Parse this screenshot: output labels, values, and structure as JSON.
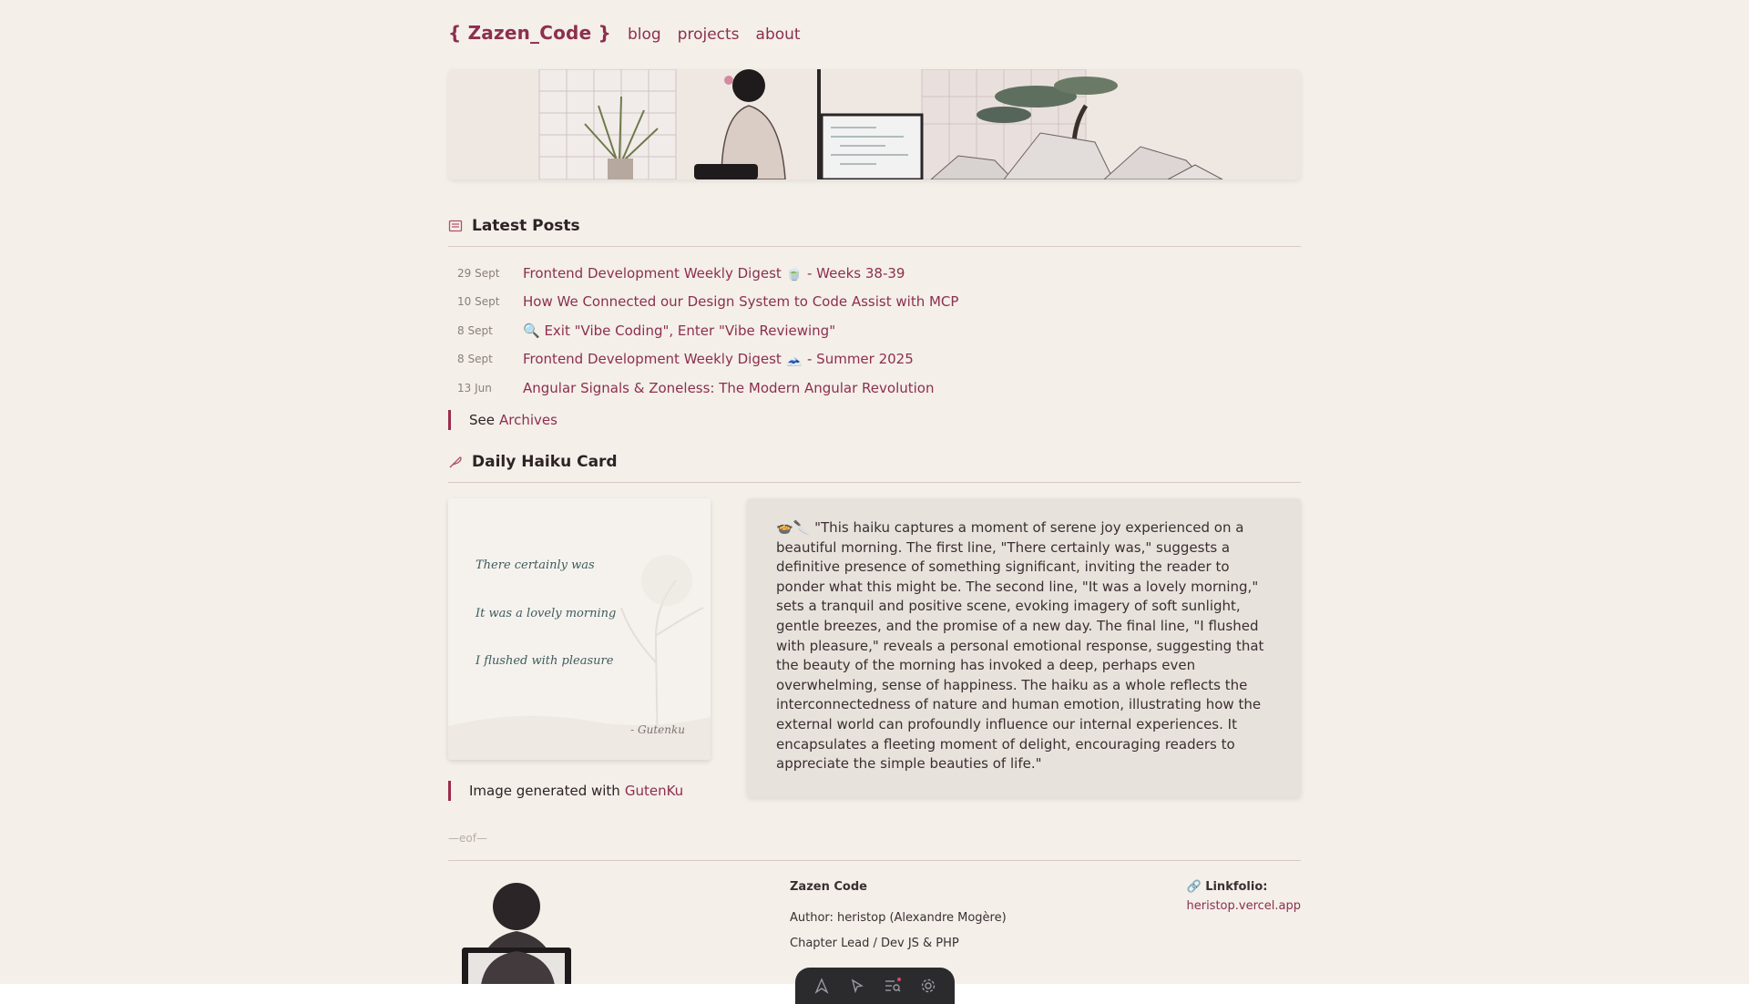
{
  "header": {
    "logo": "{ Zazen_Code }",
    "nav": [
      "blog",
      "projects",
      "about"
    ]
  },
  "latest_posts": {
    "title": "Latest Posts",
    "posts": [
      {
        "date": "29 Sept",
        "title": "Frontend Development Weekly Digest 🍵 - Weeks 38-39"
      },
      {
        "date": "10 Sept",
        "title": "How We Connected our Design System to Code Assist with MCP"
      },
      {
        "date": "8 Sept",
        "title": "🔍 Exit \"Vibe Coding\", Enter \"Vibe Reviewing\""
      },
      {
        "date": "8 Sept",
        "title": "Frontend Development Weekly Digest 🗻 - Summer 2025"
      },
      {
        "date": "13 Jun",
        "title": "Angular Signals & Zoneless: The Modern Angular Revolution"
      }
    ],
    "see_prefix": "See",
    "see_link": "Archives"
  },
  "haiku": {
    "title": "Daily Haiku Card",
    "lines": [
      "There certainly was",
      "It was a lovely morning",
      "I flushed with pleasure"
    ],
    "signature": "- Gutenku",
    "credit_prefix": "Image generated with",
    "credit_link": "GutenKu",
    "explanation": "🍲🔪 \"This haiku captures a moment of serene joy experienced on a beautiful morning. The first line, \"There certainly was,\" suggests a definitive presence of something significant, inviting the reader to ponder what this might be. The second line, \"It was a lovely morning,\" sets a tranquil and positive scene, evoking imagery of soft sunlight, gentle breezes, and the promise of a new day. The final line, \"I flushed with pleasure,\" reveals a personal emotional response, suggesting that the beauty of the morning has invoked a deep, perhaps even overwhelming, sense of happiness. The haiku as a whole reflects the interconnectedness of nature and human emotion, illustrating how the external world can profoundly influence our internal experiences. It encapsulates a fleeting moment of delight, encouraging readers to appreciate the simple beauties of life.\""
  },
  "footer": {
    "eof": "—eof—",
    "name": "Zazen Code",
    "author": "Author: heristop (Alexandre Mogère)",
    "role": "Chapter Lead / Dev JS & PHP",
    "linkfolio_label": "🔗 Linkfolio:",
    "linkfolio_url": "heristop.vercel.app"
  },
  "toolbar": {
    "icons": [
      "astro-icon",
      "inspect-cursor-icon",
      "audit-icon",
      "settings-icon"
    ]
  },
  "colors": {
    "accent": "#8c2f4f",
    "background": "#f4efe9"
  }
}
